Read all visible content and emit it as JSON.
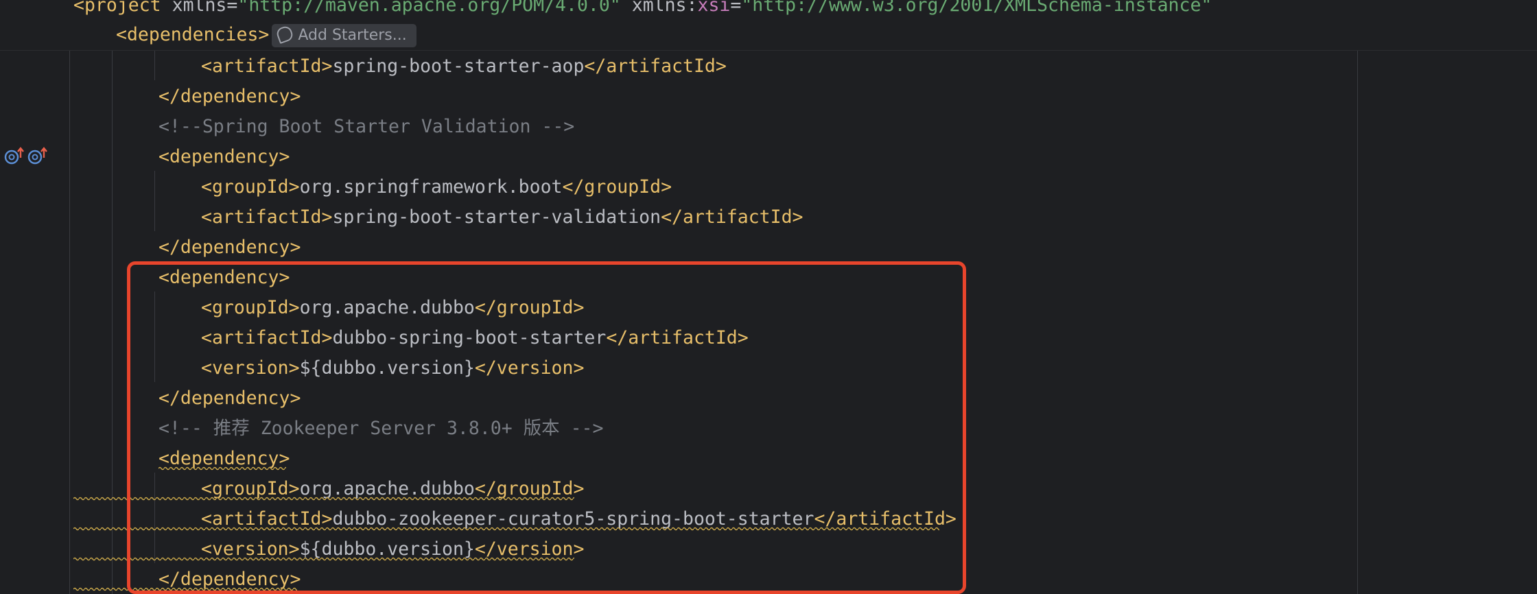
{
  "sticky": {
    "project_open": "<project",
    "xmlns_attr": "xmlns",
    "xmlns_value": "\"http://maven.apache.org/POM/4.0.0\"",
    "xsi_prefix": "xmlns",
    "xsi_ns": "xsi",
    "xsi_value": "\"http://www.w3.org/2001/XMLSchema-instance\"",
    "dependencies_tag": "<dependencies>",
    "add_starters_label": "Add Starters..."
  },
  "lines": {
    "l1_open": "<artifactId>",
    "l1_text": "spring-boot-starter-aop",
    "l1_close": "</artifactId>",
    "l2": "</dependency>",
    "l3_comment": "<!--Spring Boot Starter Validation -->",
    "l4": "<dependency>",
    "l5_open": "<groupId>",
    "l5_text": "org.springframework.boot",
    "l5_close": "</groupId>",
    "l6_open": "<artifactId>",
    "l6_text": "spring-boot-starter-validation",
    "l6_close": "</artifactId>",
    "l7": "</dependency>",
    "l8": "<dependency>",
    "l9_open": "<groupId>",
    "l9_text": "org.apache.dubbo",
    "l9_close": "</groupId>",
    "l10_open": "<artifactId>",
    "l10_text": "dubbo-spring-boot-starter",
    "l10_close": "</artifactId>",
    "l11_open": "<version>",
    "l11_text": "${dubbo.version}",
    "l11_close": "</version>",
    "l12": "</dependency>",
    "l13_comment": "<!-- 推荐 Zookeeper Server 3.8.0+ 版本 -->",
    "l14": "<dependency>",
    "l15_open": "<groupId>",
    "l15_text": "org.apache.dubbo",
    "l15_close": "</groupId>",
    "l16_open": "<artifactId>",
    "l16_text": "dubbo-zookeeper-curator5-spring-boot-starter",
    "l16_close": "</artifactId>",
    "l17_open": "<version>",
    "l17_text": "${dubbo.version}",
    "l17_close": "</version>",
    "l18": "</dependency>"
  },
  "gutter": {
    "icons": [
      "overrides-up-icon",
      "overrides-up-icon"
    ]
  },
  "colors": {
    "background": "#1e1f22",
    "tag": "#e8bf6a",
    "string": "#6aab73",
    "comment": "#7a7e85",
    "highlight": "#e8452c"
  }
}
